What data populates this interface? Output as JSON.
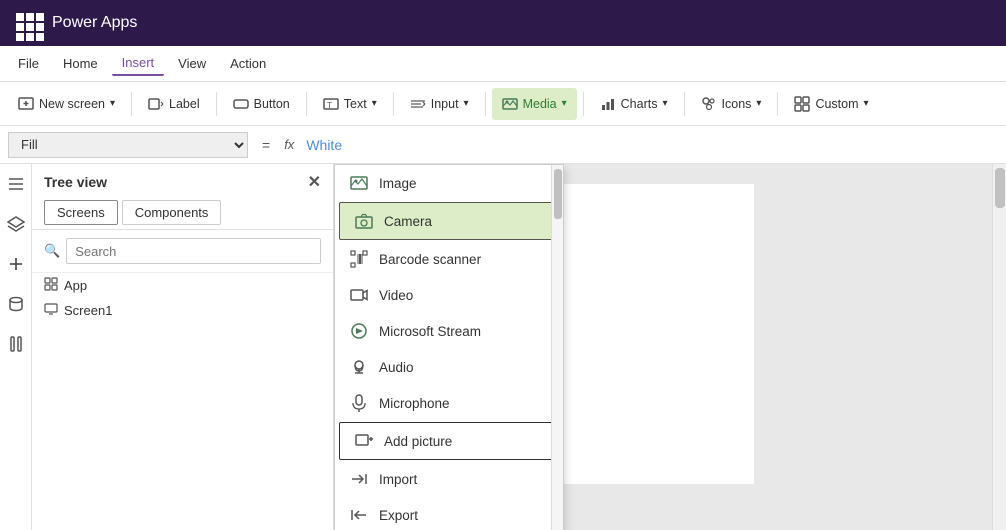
{
  "app": {
    "title": "Power Apps"
  },
  "menu": {
    "items": [
      {
        "label": "File",
        "active": false
      },
      {
        "label": "Home",
        "active": false
      },
      {
        "label": "Insert",
        "active": true
      },
      {
        "label": "View",
        "active": false
      },
      {
        "label": "Action",
        "active": false
      }
    ]
  },
  "toolbar": {
    "new_screen_label": "New screen",
    "label_label": "Label",
    "button_label": "Button",
    "text_label": "Text",
    "input_label": "Input",
    "media_label": "Media",
    "charts_label": "Charts",
    "icons_label": "Icons",
    "custom_label": "Custom"
  },
  "formula_bar": {
    "fill_label": "Fill",
    "value": "White"
  },
  "tree_view": {
    "title": "Tree view",
    "tabs": [
      {
        "label": "Screens",
        "active": true
      },
      {
        "label": "Components",
        "active": false
      }
    ],
    "search_placeholder": "Search",
    "items": [
      {
        "label": "App",
        "icon": "app-icon"
      },
      {
        "label": "Screen1",
        "icon": "screen-icon"
      }
    ]
  },
  "media_dropdown": {
    "items": [
      {
        "label": "Image",
        "icon": "image-icon",
        "highlighted": false
      },
      {
        "label": "Camera",
        "icon": "camera-icon",
        "highlighted": true,
        "bordered": true
      },
      {
        "label": "Barcode scanner",
        "icon": "barcode-icon",
        "highlighted": false
      },
      {
        "label": "Video",
        "icon": "video-icon",
        "highlighted": false
      },
      {
        "label": "Microsoft Stream",
        "icon": "stream-icon",
        "highlighted": false
      },
      {
        "label": "Audio",
        "icon": "audio-icon",
        "highlighted": false
      },
      {
        "label": "Microphone",
        "icon": "microphone-icon",
        "highlighted": false
      },
      {
        "label": "Add picture",
        "icon": "add-picture-icon",
        "highlighted": false,
        "bordered": true
      },
      {
        "label": "Import",
        "icon": "import-icon",
        "highlighted": false
      },
      {
        "label": "Export",
        "icon": "export-icon",
        "highlighted": false
      }
    ]
  }
}
